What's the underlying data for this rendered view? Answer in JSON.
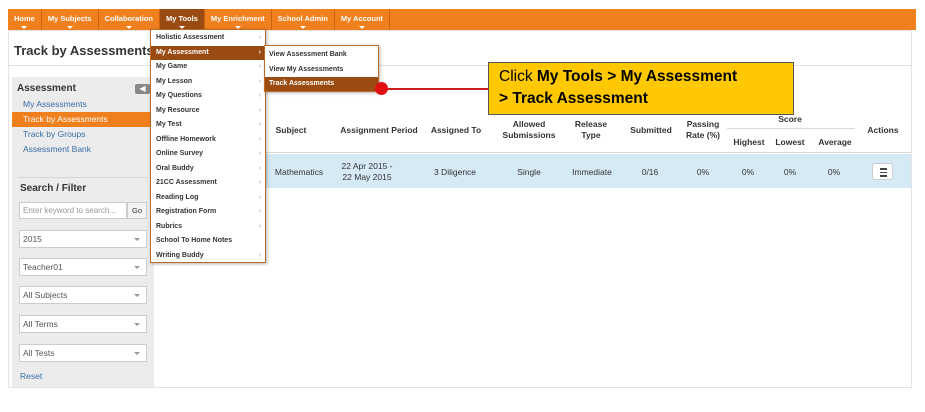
{
  "nav": {
    "items": [
      {
        "label": "Home",
        "active": false
      },
      {
        "label": "My Subjects",
        "active": false
      },
      {
        "label": "Collaboration",
        "active": false
      },
      {
        "label": "My Tools",
        "active": true
      },
      {
        "label": "My Enrichment",
        "active": false
      },
      {
        "label": "School Admin",
        "active": false
      },
      {
        "label": "My Account",
        "active": false
      }
    ]
  },
  "page": {
    "title": "Track by Assessments"
  },
  "sidebar": {
    "heading": "Assessment",
    "collapse_glyph": "◀",
    "links": [
      {
        "label": "My Assessments",
        "active": false
      },
      {
        "label": "Track by Assessments",
        "active": true
      },
      {
        "label": "Track by Groups",
        "active": false
      },
      {
        "label": "Assessment Bank",
        "active": false
      }
    ],
    "filter_heading": "Search / Filter",
    "search_placeholder": "Enter keyword to search...",
    "go_label": "Go",
    "selects": [
      "2015",
      "Teacher01",
      "All Subjects",
      "All Terms",
      "All Tests"
    ],
    "reset_label": "Reset"
  },
  "menu": {
    "items": [
      "Holistic Assessment",
      "My Assessment",
      "My Game",
      "My Lesson",
      "My Questions",
      "My Resource",
      "My Test",
      "Offline Homework",
      "Online Survey",
      "Oral Buddy",
      "21CC Assessment",
      "Reading Log",
      "Registration Form",
      "Rubrics",
      "School To Home Notes",
      "Writing Buddy"
    ],
    "active_index": 1,
    "no_submenu_index": 14,
    "submenu_glyph": "›",
    "submenu": [
      "View Assessment Bank",
      "View My Assessments",
      "Track Assessments"
    ],
    "submenu_active_index": 2
  },
  "callout": {
    "prefix": "Click ",
    "line1_bold": "My Tools > My Assessment",
    "line2_bold": "> Track Assessment"
  },
  "table": {
    "headers": {
      "subject": "Subject",
      "period": "Assignment Period",
      "assigned_to": "Assigned To",
      "allowed": "Allowed Submissions",
      "release": "Release Type",
      "submitted": "Submitted",
      "passing": "Passing Rate (%)",
      "score": "Score",
      "highest": "Highest",
      "lowest": "Lowest",
      "average": "Average",
      "actions": "Actions"
    },
    "row": {
      "subject": "Mathematics",
      "period_line1": "22 Apr 2015 -",
      "period_line2": "22 May 2015",
      "assigned_to": "3 Diligence",
      "allowed": "Single",
      "release": "Immediate",
      "submitted": "0/16",
      "passing": "0%",
      "highest": "0%",
      "lowest": "0%",
      "average": "0%"
    }
  },
  "colors": {
    "nav_orange": "#f07f1d",
    "active_brown": "#9a4b12",
    "row_blue": "#d6eaf6",
    "callout_yellow": "#ffc800",
    "callout_red": "#e01010"
  }
}
